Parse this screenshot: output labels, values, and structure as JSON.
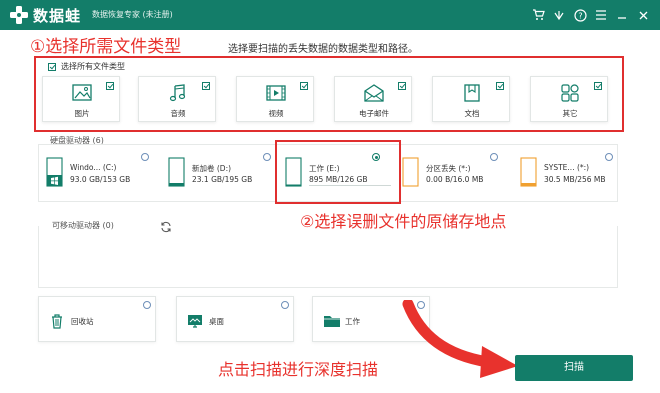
{
  "titlebar": {
    "logo_text": "数据蛙",
    "app_title": "数据恢复专家 (未注册)",
    "icons": [
      "cart-icon",
      "gift-icon",
      "help-icon",
      "menu-icon",
      "minimize-icon",
      "close-icon"
    ]
  },
  "annotations": {
    "step1": "①选择所需文件类型",
    "step1_sub": "选择要扫描的丢失数据的数据类型和路径。",
    "step2": "②选择误删文件的原储存地点",
    "step3": "点击扫描进行深度扫描"
  },
  "file_types": {
    "select_all_label": "选择所有文件类型",
    "select_all_checked": true,
    "items": [
      {
        "label": "图片",
        "icon": "image-icon",
        "checked": true
      },
      {
        "label": "音频",
        "icon": "music-icon",
        "checked": true
      },
      {
        "label": "视频",
        "icon": "video-icon",
        "checked": true
      },
      {
        "label": "电子邮件",
        "icon": "mail-icon",
        "checked": true
      },
      {
        "label": "文档",
        "icon": "document-icon",
        "checked": true
      },
      {
        "label": "其它",
        "icon": "other-icon",
        "checked": true
      }
    ]
  },
  "disks": {
    "title": "硬盘驱动器 (6)",
    "items": [
      {
        "name": "Windo... (C:)",
        "size": "93.0 GB/153 GB",
        "selected": false,
        "usage": 0.61,
        "color": "#137d69"
      },
      {
        "name": "新加卷 (D:)",
        "size": "23.1 GB/195 GB",
        "selected": false,
        "usage": 0.12,
        "color": "#137d69"
      },
      {
        "name": "工作 (E:)",
        "size": "895 MB/126 GB",
        "selected": true,
        "usage": 0.01,
        "color": "#137d69"
      },
      {
        "name": "分区丢失 (*:)",
        "size": "0.00  B/16.0 MB",
        "selected": false,
        "usage": 0.0,
        "color": "#f0a030"
      },
      {
        "name": "SYSTE... (*:)",
        "size": "30.5 MB/256 MB",
        "selected": false,
        "usage": 0.12,
        "color": "#f0a030"
      }
    ]
  },
  "removable": {
    "title": "可移动驱动器 (0)"
  },
  "locations": [
    {
      "label": "回收站",
      "icon": "recycle-bin-icon"
    },
    {
      "label": "桌面",
      "icon": "desktop-icon"
    },
    {
      "label": "工作",
      "icon": "folder-icon"
    }
  ],
  "scan_button": "扫描",
  "colors": {
    "brand": "#137d69",
    "annotation": "#e8322d"
  }
}
